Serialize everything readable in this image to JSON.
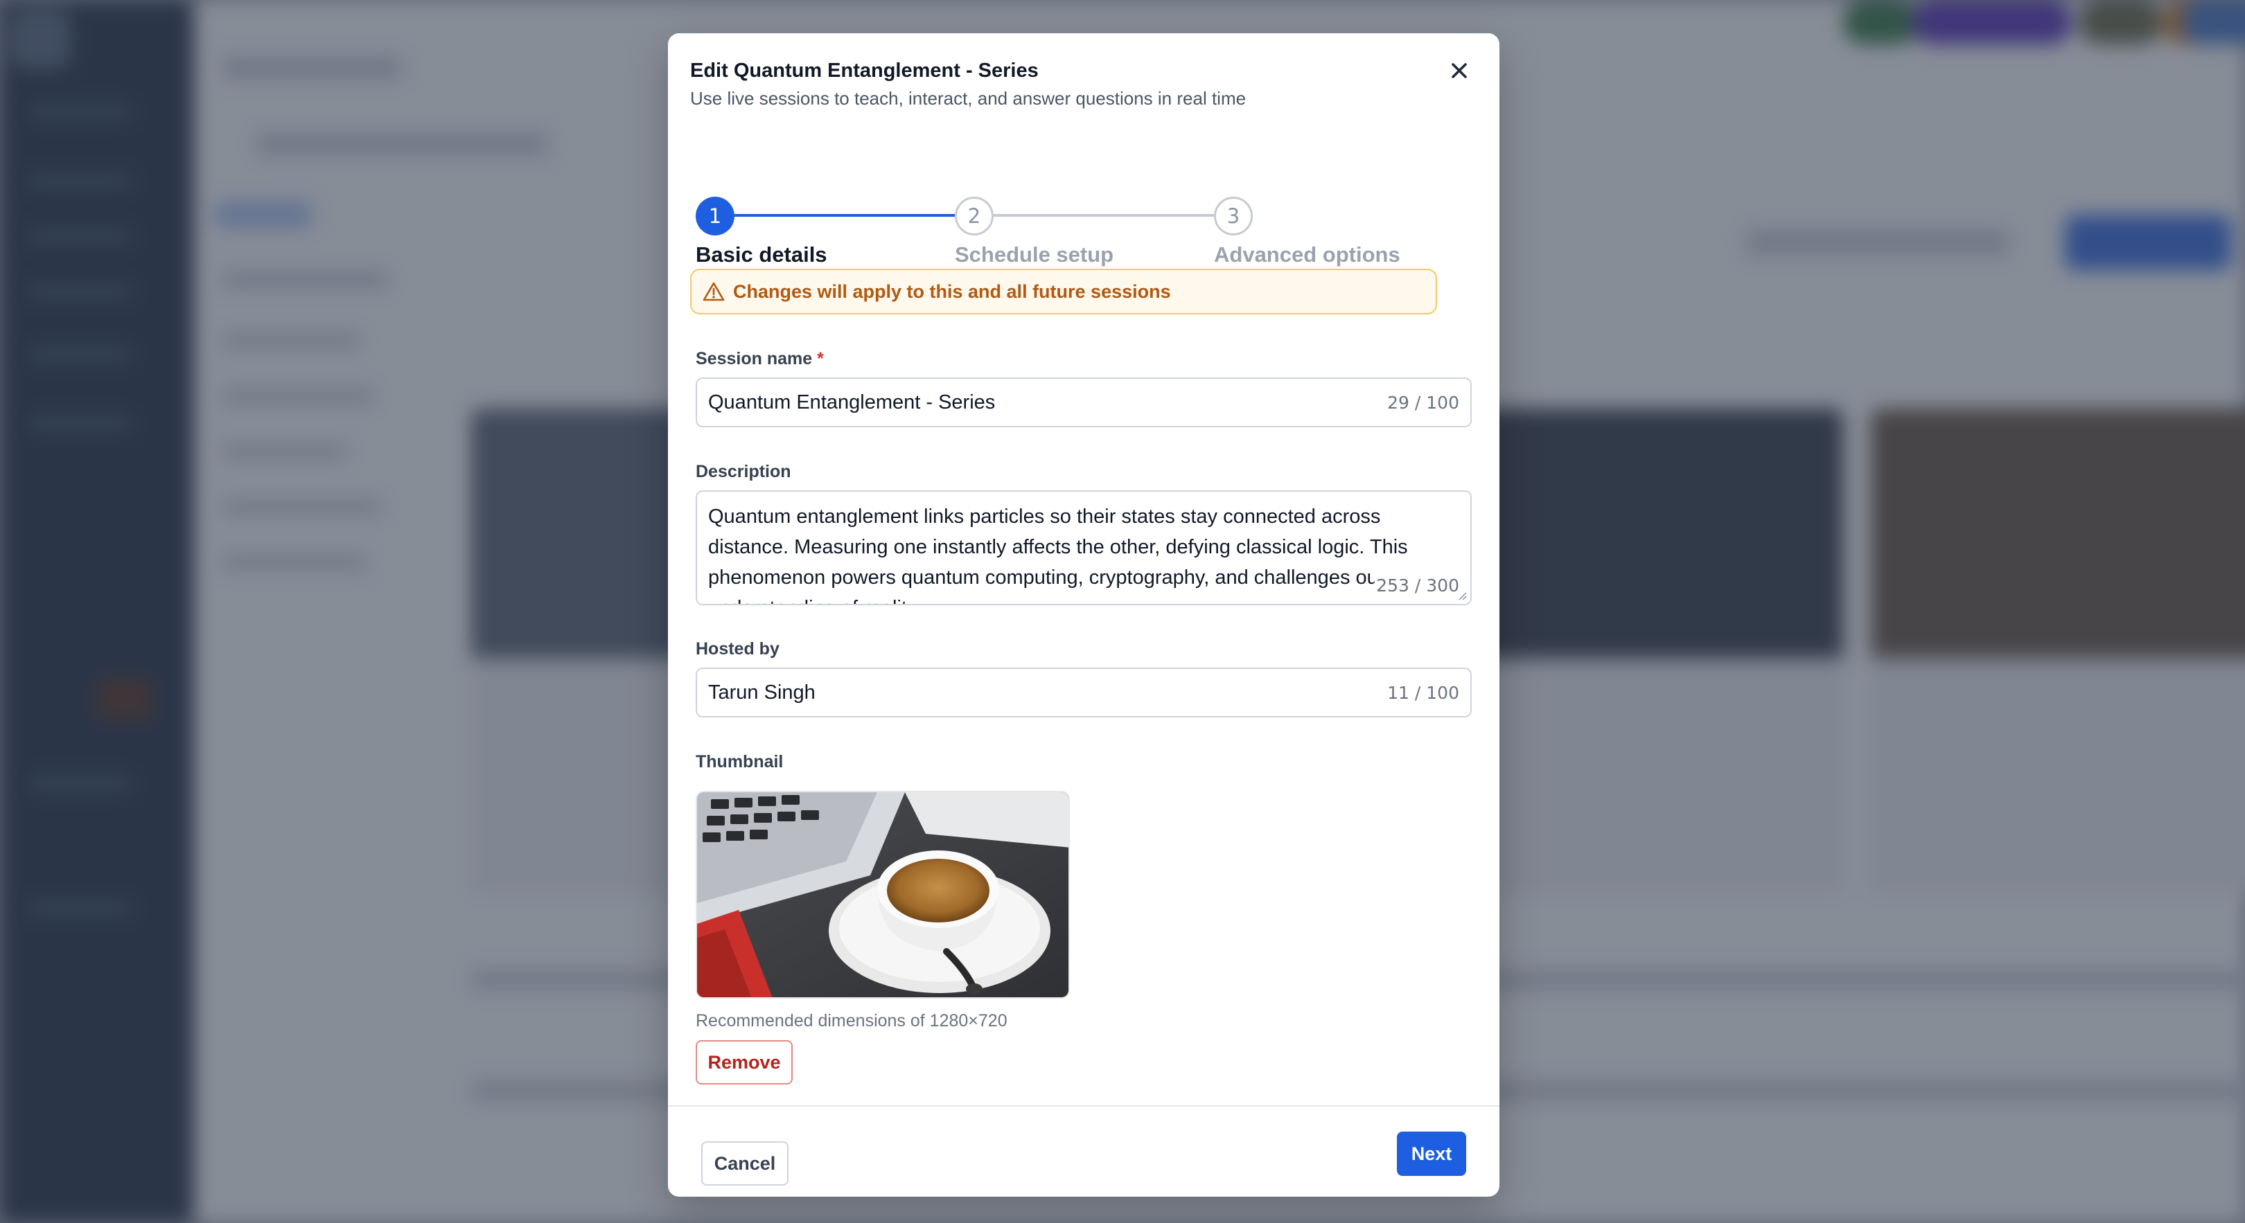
{
  "modal": {
    "title": "Edit Quantum Entanglement - Series",
    "subtitle": "Use live sessions to teach, interact, and answer questions in real time",
    "close_icon": "close-icon"
  },
  "stepper": {
    "current_step": 1,
    "steps": [
      {
        "number": "1",
        "label": "Basic details"
      },
      {
        "number": "2",
        "label": "Schedule setup"
      },
      {
        "number": "3",
        "label": "Advanced options"
      }
    ]
  },
  "banner": {
    "icon": "warning-triangle-icon",
    "text": "Changes will apply to this and all future sessions"
  },
  "fields": {
    "session_name": {
      "label": "Session name",
      "required_mark": "*",
      "value": "Quantum Entanglement - Series",
      "counter": "29 / 100"
    },
    "description": {
      "label": "Description",
      "value": "Quantum entanglement links particles so their states stay connected across distance. Measuring one instantly affects the other, defying classical logic. This phenomenon powers quantum computing, cryptography, and challenges our understanding of reality.",
      "counter": "253 / 300"
    },
    "hosted_by": {
      "label": "Hosted by",
      "value": "Tarun Singh",
      "counter": "11 / 100"
    },
    "thumbnail": {
      "label": "Thumbnail",
      "hint": "Recommended dimensions of 1280×720",
      "remove_label": "Remove"
    }
  },
  "footer": {
    "cancel_label": "Cancel",
    "next_label": "Next"
  },
  "colors": {
    "accent": "#1d5fe0",
    "warning_text": "#b05a12",
    "warning_bg": "#fff8ec",
    "warning_border": "#f3c869",
    "danger": "#b4231b"
  }
}
